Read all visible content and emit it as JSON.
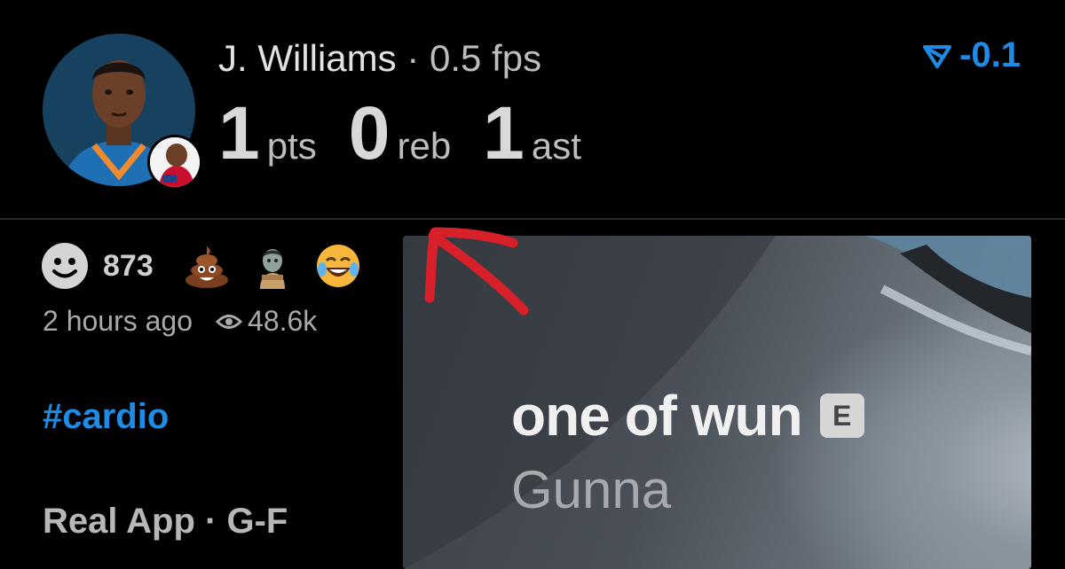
{
  "player": {
    "name": "J. Williams",
    "separator": "·",
    "fps": "0.5 fps",
    "stats": [
      {
        "value": "1",
        "unit": "pts"
      },
      {
        "value": "0",
        "unit": "reb"
      },
      {
        "value": "1",
        "unit": "ast"
      }
    ]
  },
  "rating": {
    "icon": "rating-down-arrow-icon",
    "value": "-0.1",
    "color": "#1e8ce6"
  },
  "reactions": {
    "count": "873",
    "icons": [
      "smiley-face-icon",
      "poop-emoji-icon",
      "zombie-emoji-icon",
      "laughing-crying-emoji-icon"
    ]
  },
  "meta": {
    "time": "2 hours ago",
    "views": "48.6k"
  },
  "hashtag": "#cardio",
  "source": {
    "app": "Real App",
    "separator": "·",
    "position": "G-F"
  },
  "song": {
    "title": "one of wun",
    "explicit_label": "E",
    "artist": "Gunna"
  },
  "annotation": {
    "color": "#d8202a"
  }
}
